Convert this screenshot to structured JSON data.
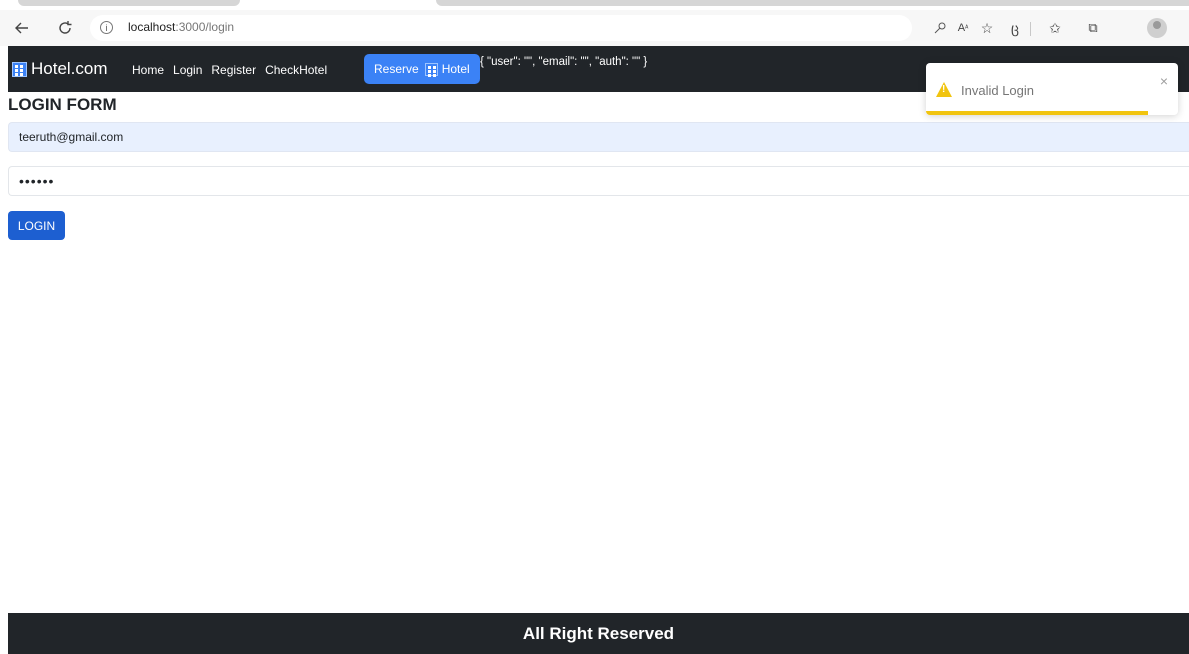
{
  "browser": {
    "url_host": "localhost",
    "url_path": ":3000/login",
    "info_icon": "info-icon",
    "icons": [
      "back-arrow-icon",
      "refresh-icon",
      "key-icon",
      "read-aloud-icon",
      "favorite-icon",
      "extensions-icon",
      "favorites-list-icon",
      "collections-icon",
      "profile-icon"
    ]
  },
  "navbar": {
    "brand": "Hotel.com",
    "links": [
      "Home",
      "Login",
      "Register",
      "CheckHotel"
    ],
    "reserve_label": "Reserve",
    "reserve_suffix": "Hotel",
    "state_text": "{ \"user\": \"\", \"email\": \"\", \"auth\": \"\" }",
    "background": "#212529",
    "accent": "#3b82f6"
  },
  "form": {
    "title": "LOGIN FORM",
    "email_value": "teeruth@gmail.com",
    "password_value": "••••••",
    "login_label": "LOGIN",
    "button_color": "#1d5fd1"
  },
  "toast": {
    "message": "Invalid Login",
    "close": "×",
    "type": "warning",
    "progress_fraction": 0.88,
    "color": "#f1c40f"
  },
  "footer": {
    "text": "All Right Reserved"
  }
}
